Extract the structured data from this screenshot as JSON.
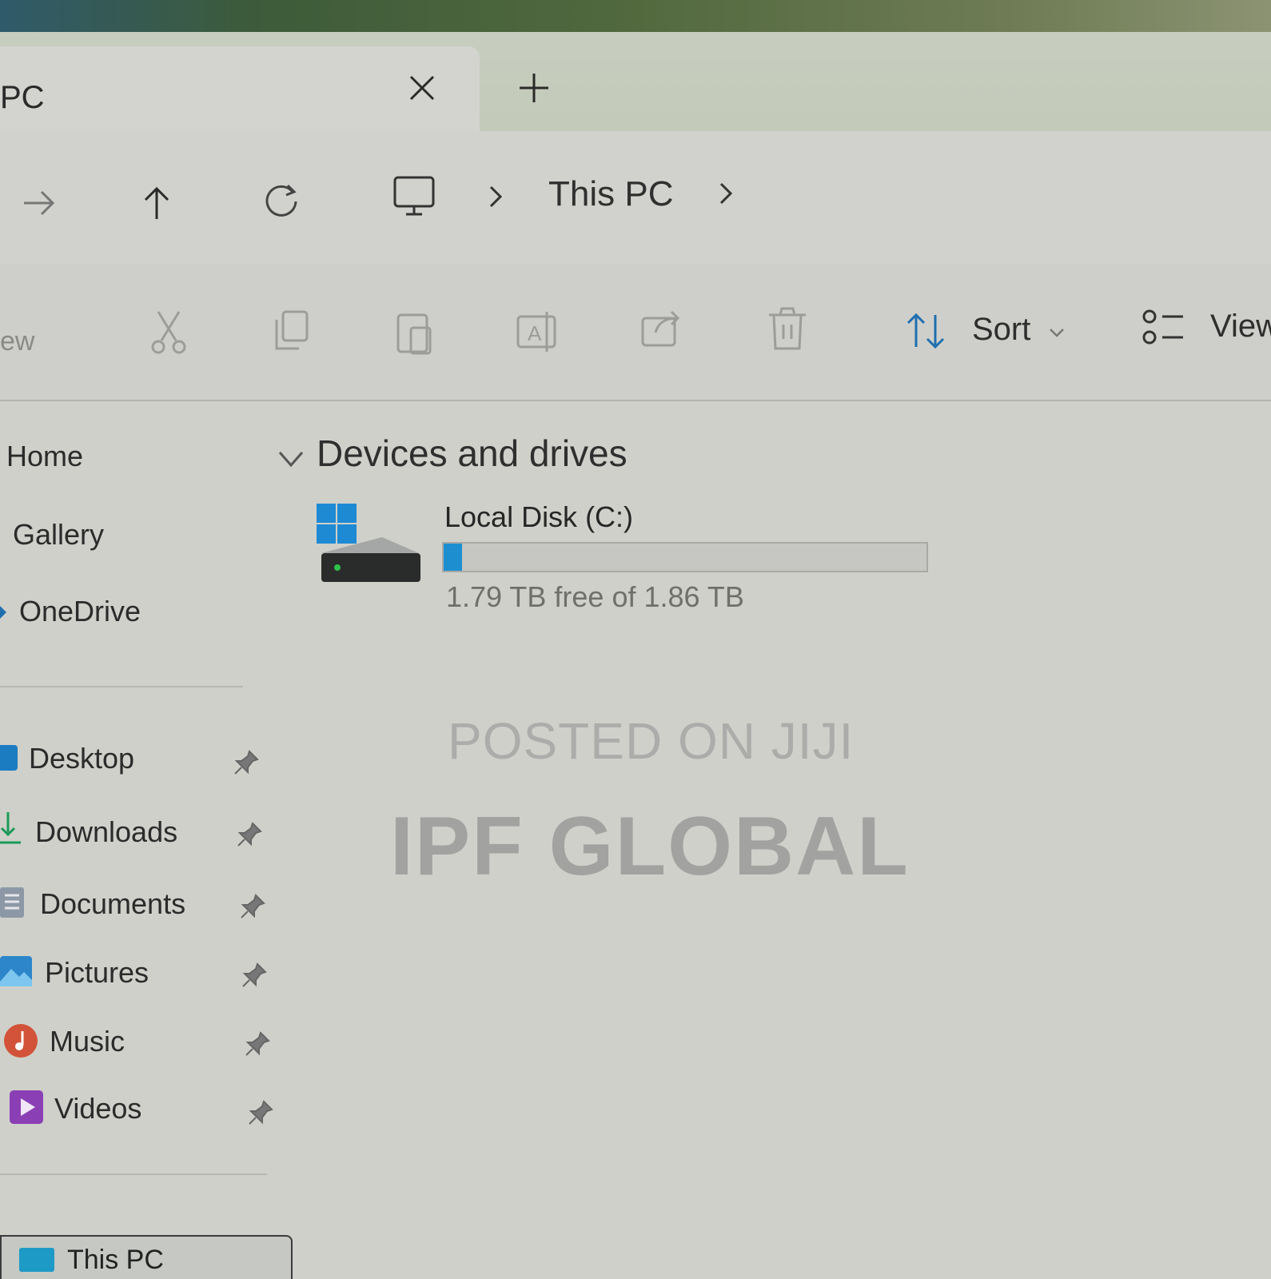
{
  "window": {
    "tab_title": "PC",
    "close_tab": "close-icon",
    "new_tab": "plus-icon"
  },
  "address": {
    "breadcrumb": [
      "This PC"
    ],
    "icons": [
      "forward-icon",
      "up-icon",
      "refresh-icon",
      "monitor-icon",
      "chevron-right-icon"
    ]
  },
  "toolbar": {
    "new_label": "ew",
    "sort_label": "Sort",
    "view_label": "View",
    "icons": [
      "cut-icon",
      "copy-icon",
      "paste-icon",
      "rename-icon",
      "share-icon",
      "delete-icon",
      "sort-icon",
      "view-icon"
    ]
  },
  "sidebar": {
    "items": [
      {
        "label": "Home"
      },
      {
        "label": "Gallery"
      },
      {
        "label": "OneDrive"
      }
    ],
    "pinned": [
      {
        "label": "Desktop",
        "icon": "desktop-folder-icon"
      },
      {
        "label": "Downloads",
        "icon": "downloads-folder-icon"
      },
      {
        "label": "Documents",
        "icon": "documents-folder-icon"
      },
      {
        "label": "Pictures",
        "icon": "pictures-folder-icon"
      },
      {
        "label": "Music",
        "icon": "music-folder-icon"
      },
      {
        "label": "Videos",
        "icon": "videos-folder-icon"
      }
    ],
    "this_pc": "This PC"
  },
  "content": {
    "section_title": "Devices and drives",
    "drive": {
      "name": "Local Disk (C:)",
      "free_text": "1.79 TB free of 1.86 TB",
      "used_fraction": 0.038,
      "bar_color": "#1d8fd0"
    }
  },
  "watermark": {
    "line1": "POSTED ON JIJI",
    "line2": "IPF GLOBAL"
  }
}
